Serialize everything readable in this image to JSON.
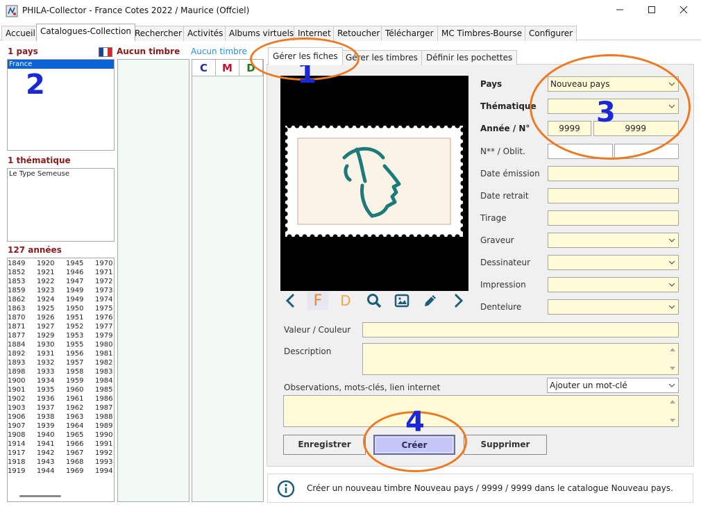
{
  "window": {
    "title": "PHILA-Collector - France Cotes 2022 / Maurice (Offciel)"
  },
  "menu_tabs": [
    {
      "label": "Accueil"
    },
    {
      "label": "Catalogues-Collection",
      "active": true
    },
    {
      "label": "Rechercher"
    },
    {
      "label": "Activités"
    },
    {
      "label": "Albums virtuels"
    },
    {
      "label": "Internet"
    },
    {
      "label": "Retoucher"
    },
    {
      "label": "Télécharger"
    },
    {
      "label": "MC Timbres-Bourse"
    },
    {
      "label": "Configurer"
    }
  ],
  "left": {
    "pays_header": "1 pays",
    "pays_items": [
      "France"
    ],
    "thematique_header": "1 thématique",
    "thematique_items": [
      "Le Type Semeuse"
    ],
    "annees_header": "127 années",
    "years": [
      [
        "1849",
        "1852",
        "1853",
        "1859",
        "1862",
        "1863",
        "1870",
        "1871",
        "1877",
        "1884",
        "1892",
        "1893",
        "1898",
        "1900",
        "1901",
        "1902",
        "1903",
        "1906",
        "1907",
        "1908",
        "1914",
        "1917",
        "1918",
        "1919"
      ],
      [
        "1920",
        "1921",
        "1922",
        "1923",
        "1924",
        "1925",
        "1926",
        "1927",
        "1929",
        "1930",
        "1931",
        "1932",
        "1933",
        "1934",
        "1935",
        "1936",
        "1937",
        "1938",
        "1939",
        "1940",
        "1941",
        "1942",
        "1943",
        "1944"
      ],
      [
        "1945",
        "1946",
        "1947",
        "1949",
        "1949",
        "1950",
        "1951",
        "1952",
        "1953",
        "1955",
        "1956",
        "1957",
        "1958",
        "1959",
        "1960",
        "1961",
        "1962",
        "1963",
        "1964",
        "1965",
        "1966",
        "1967",
        "1968",
        "1969"
      ],
      [
        "1970",
        "1971",
        "1972",
        "1973",
        "1974",
        "1975",
        "1976",
        "1977",
        "1979",
        "1980",
        "1981",
        "1982",
        "1983",
        "1984",
        "1985",
        "1986",
        "1987",
        "1988",
        "1989",
        "1990",
        "1991",
        "1992",
        "1993",
        "1994"
      ]
    ]
  },
  "middle": {
    "aucun_timbre_1": "Aucun timbre",
    "aucun_timbre_2": "Aucun timbre",
    "col_c": "C",
    "col_m": "M",
    "col_d": "D"
  },
  "subtabs": [
    {
      "label": "Gérer les fiches",
      "active": true
    },
    {
      "label": "Gérer les timbres"
    },
    {
      "label": "Définir les pochettes"
    }
  ],
  "toolbar": {
    "f_label": "F",
    "d_label": "D"
  },
  "form": {
    "pays_label": "Pays",
    "pays_value": "Nouveau pays",
    "thematique_label": "Thématique",
    "thematique_value": "",
    "annee_label": "Année / N°",
    "annee_value": "9999",
    "numero_value": "9999",
    "oblit_label": "N** / Oblit.",
    "date_emission_label": "Date émission",
    "date_retrait_label": "Date retrait",
    "tirage_label": "Tirage",
    "graveur_label": "Graveur",
    "dessinateur_label": "Dessinateur",
    "impression_label": "Impression",
    "dentelure_label": "Dentelure",
    "valeur_label": "Valeur / Couleur",
    "description_label": "Description",
    "observations_label": "Observations, mots-clés, lien internet",
    "mot_cle_value": "Ajouter un mot-clé"
  },
  "buttons": {
    "enregistrer": "Enregistrer",
    "creer": "Créer",
    "supprimer": "Supprimer"
  },
  "status": {
    "message": "Créer un nouveau timbre Nouveau pays / 9999 / 9999 dans le catalogue Nouveau pays."
  },
  "annotations": {
    "n1": "1",
    "n2": "2",
    "n3": "3",
    "n4": "4",
    "ring_color": "#ed7a21",
    "number_color": "#1a28d6"
  },
  "colors": {
    "field_bg": "#fffbd9",
    "selection": "#0a64d6",
    "header_red": "#8b1a1a",
    "accent_teal": "#1c7a7a",
    "create_button": "#c4c6f7"
  }
}
